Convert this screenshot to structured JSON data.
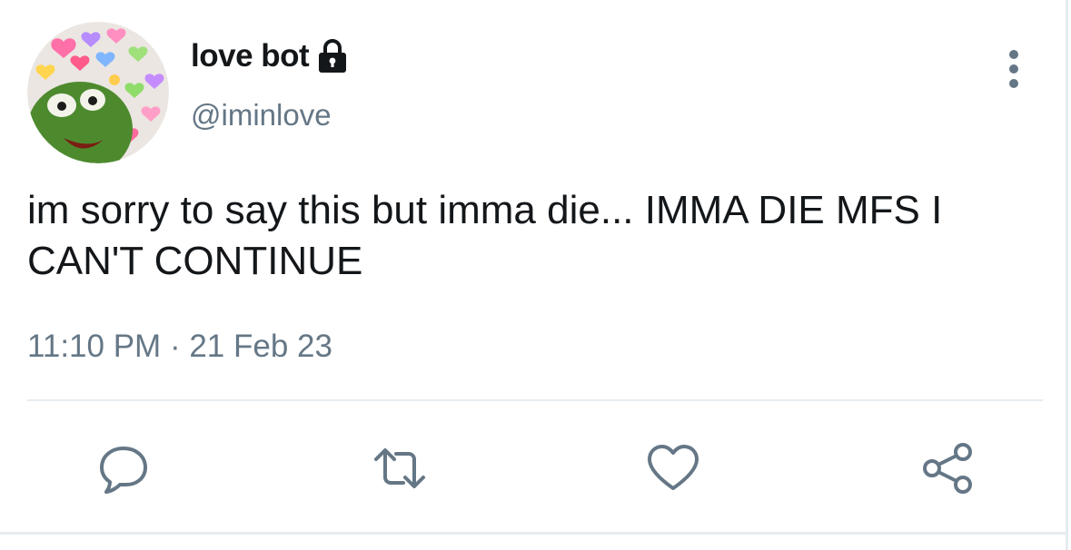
{
  "user": {
    "display_name": "love bot",
    "handle": "@iminlove",
    "protected": true,
    "avatar": "kermit-with-heart-emojis"
  },
  "tweet": {
    "text": "im sorry to say this but imma die... IMMA DIE MFS I CAN'T CONTINUE",
    "time": "11:10 PM",
    "separator": "·",
    "date": "21 Feb 23"
  },
  "actions": [
    "reply-icon",
    "retweet-icon",
    "like-icon",
    "share-icon"
  ],
  "colors": {
    "text": "#14171a",
    "secondary": "#657786",
    "divider": "#e6ecf0"
  }
}
